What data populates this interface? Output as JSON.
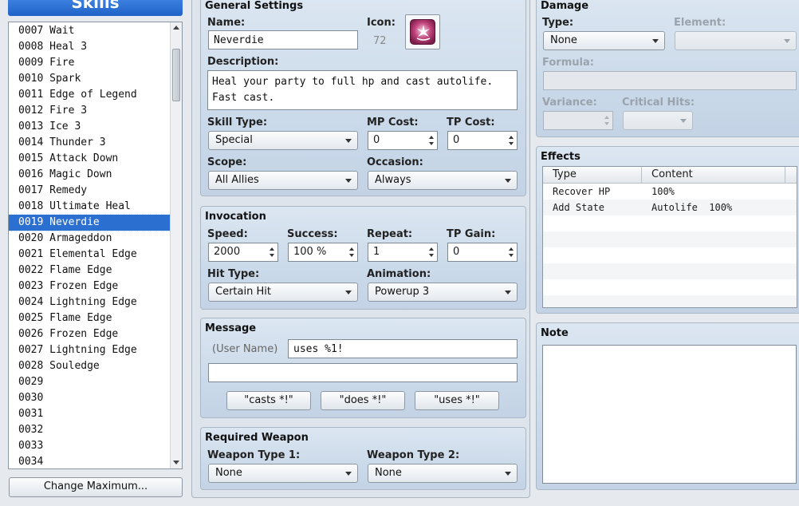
{
  "skills_panel": {
    "title": "Skills",
    "items": [
      "0007 Wait",
      "0008 Heal 3",
      "0009 Fire",
      "0010 Spark",
      "0011 Edge of Legend",
      "0012 Fire 3",
      "0013 Ice 3",
      "0014 Thunder 3",
      "0015 Attack Down",
      "0016 Magic Down",
      "0017 Remedy",
      "0018 Ultimate Heal",
      "0019 Neverdie",
      "0020 Armageddon",
      "0021 Elemental Edge",
      "0022 Flame Edge",
      "0023 Frozen Edge",
      "0024 Lightning Edge",
      "0025 Flame Edge",
      "0026 Frozen Edge",
      "0027 Lightning Edge",
      "0028 Souledge",
      "0029",
      "0030",
      "0031",
      "0032",
      "0033",
      "0034"
    ],
    "selected_index": 12,
    "change_max_label": "Change Maximum..."
  },
  "general": {
    "title": "General Settings",
    "name_label": "Name:",
    "name_value": "Neverdie",
    "icon_label": "Icon:",
    "icon_index": "72",
    "description_label": "Description:",
    "description_line1": "Heal your party to full hp and cast autolife.",
    "description_line2": "Fast cast.",
    "skill_type_label": "Skill Type:",
    "skill_type_value": "Special",
    "mp_cost_label": "MP Cost:",
    "mp_cost_value": "0",
    "tp_cost_label": "TP Cost:",
    "tp_cost_value": "0",
    "scope_label": "Scope:",
    "scope_value": "All Allies",
    "occasion_label": "Occasion:",
    "occasion_value": "Always"
  },
  "invocation": {
    "title": "Invocation",
    "speed_label": "Speed:",
    "speed_value": "2000",
    "success_label": "Success:",
    "success_value": "100 %",
    "repeat_label": "Repeat:",
    "repeat_value": "1",
    "tp_gain_label": "TP Gain:",
    "tp_gain_value": "0",
    "hit_type_label": "Hit Type:",
    "hit_type_value": "Certain Hit",
    "animation_label": "Animation:",
    "animation_value": "Powerup 3"
  },
  "message": {
    "title": "Message",
    "user_name_label": "(User Name)",
    "line1_value": "uses %1!",
    "line2_value": "",
    "btn_casts": "\"casts *!\"",
    "btn_does": "\"does *!\"",
    "btn_uses": "\"uses *!\""
  },
  "required_weapon": {
    "title": "Required Weapon",
    "type1_label": "Weapon Type 1:",
    "type1_value": "None",
    "type2_label": "Weapon Type 2:",
    "type2_value": "None"
  },
  "damage": {
    "title": "Damage",
    "type_label": "Type:",
    "type_value": "None",
    "element_label": "Element:",
    "formula_label": "Formula:",
    "variance_label": "Variance:",
    "critical_label": "Critical Hits:"
  },
  "effects": {
    "title": "Effects",
    "col_type": "Type",
    "col_content": "Content",
    "rows": [
      {
        "type": "Recover HP",
        "content": "100%"
      },
      {
        "type": "Add State",
        "content": "Autolife  100%"
      }
    ]
  },
  "note": {
    "title": "Note",
    "value": ""
  },
  "colors": {
    "selection": "#2b6fd1",
    "header_blue": "#1f63c8",
    "group_bg": "#cfdcea"
  }
}
